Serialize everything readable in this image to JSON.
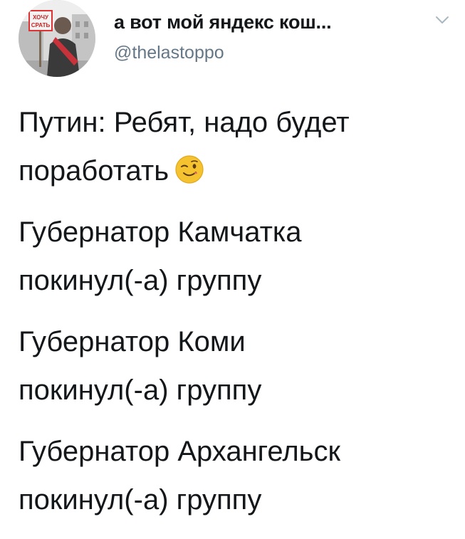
{
  "tweet": {
    "display_name": "а вот мой яндекс кош...",
    "handle": "@thelastoppo",
    "menu_icon": "chevron-down-icon",
    "avatar": {
      "icon": "avatar-photo",
      "sign_text_1": "ХОЧУ",
      "sign_text_2": "СРАТЬ"
    },
    "paragraphs": [
      {
        "lines": [
          "Путин: Ребят, надо будет",
          "поработать"
        ],
        "emoji": "winking-face-icon"
      },
      {
        "lines": [
          "Губернатор Камчатка",
          "покинул(-а) группу"
        ]
      },
      {
        "lines": [
          "Губернатор Коми",
          "покинул(-а) группу"
        ]
      },
      {
        "lines": [
          "Губернатор Архангельск",
          "покинул(-а) группу"
        ]
      }
    ]
  },
  "colors": {
    "text": "#14171a",
    "secondary": "#657786",
    "chevron": "#aab8c2",
    "emoji_face": "#f5c230"
  }
}
